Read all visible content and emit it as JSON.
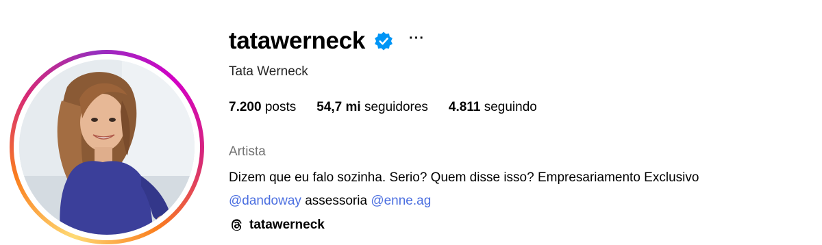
{
  "profile": {
    "username": "tatawerneck",
    "full_name": "Tata Werneck",
    "more_label": "···",
    "stats": {
      "posts_count": "7.200",
      "posts_label": "posts",
      "followers_count": "54,7 mi",
      "followers_label": "seguidores",
      "following_count": "4.811",
      "following_label": "seguindo"
    },
    "category": "Artista",
    "bio_line1": "Dizem que eu falo sozinha. Serio? Quem disse isso? Empresariamento Exclusivo",
    "mention1": "@dandoway",
    "bio_middle": "assessoria",
    "mention2": "@enne.ag",
    "threads_handle": "tatawerneck"
  },
  "icons": {
    "verified": "verified-badge-icon",
    "more": "more-options-icon",
    "threads": "threads-icon"
  },
  "colors": {
    "verified_blue": "#0095f6",
    "link_blue": "#4a6ee0",
    "category_gray": "#737373"
  }
}
